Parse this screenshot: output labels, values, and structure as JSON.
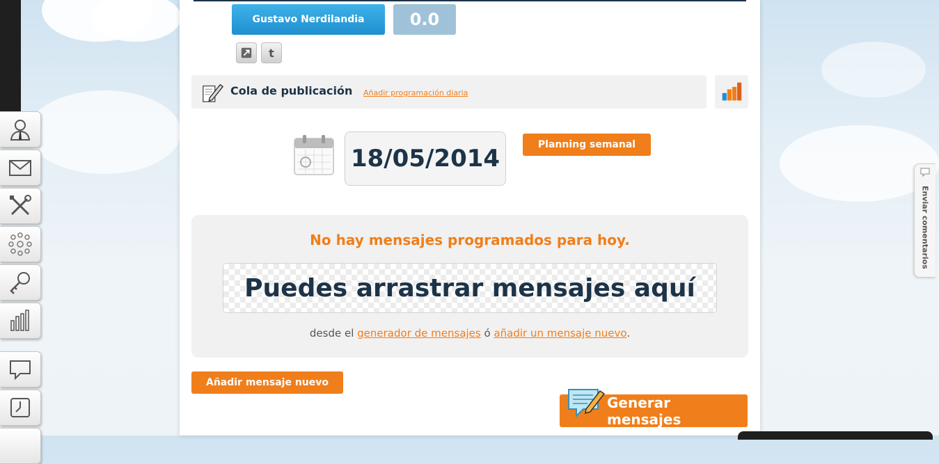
{
  "header": {
    "user_name": "Gustavo Nerdilandia",
    "score": "0.0"
  },
  "social": {
    "share_icon": "share-icon",
    "twitter_label": "t"
  },
  "queue": {
    "title": "Cola de publicación",
    "add_daily_link": "Añadir programación diaria"
  },
  "date": {
    "value": "18/05/2014",
    "planning_button": "Planning semanal"
  },
  "messages": {
    "empty_text": "No hay mensajes programados para hoy.",
    "drop_zone_text": "Puedes arrastrar mensajes aquí",
    "from_prefix": "desde el",
    "generator_link": "generador de mensajes",
    "or_text": "ó",
    "add_new_link": "añadir un mensaje nuevo",
    "suffix": "."
  },
  "actions": {
    "add_message_button": "Añadir mensaje nuevo",
    "generate_button": "Generar mensajes"
  },
  "feedback": {
    "label": "Enviar comentarios"
  },
  "sidebar": {
    "tools": [
      "user-icon",
      "mail-icon",
      "tools-icon",
      "network-icon",
      "key-icon",
      "stats-icon",
      "chat-icon",
      "clock-icon"
    ]
  },
  "colors": {
    "orange": "#f07e1a",
    "navy": "#1c3348",
    "blue": "#1f8fd0",
    "score_bg": "#9fc2d9"
  }
}
